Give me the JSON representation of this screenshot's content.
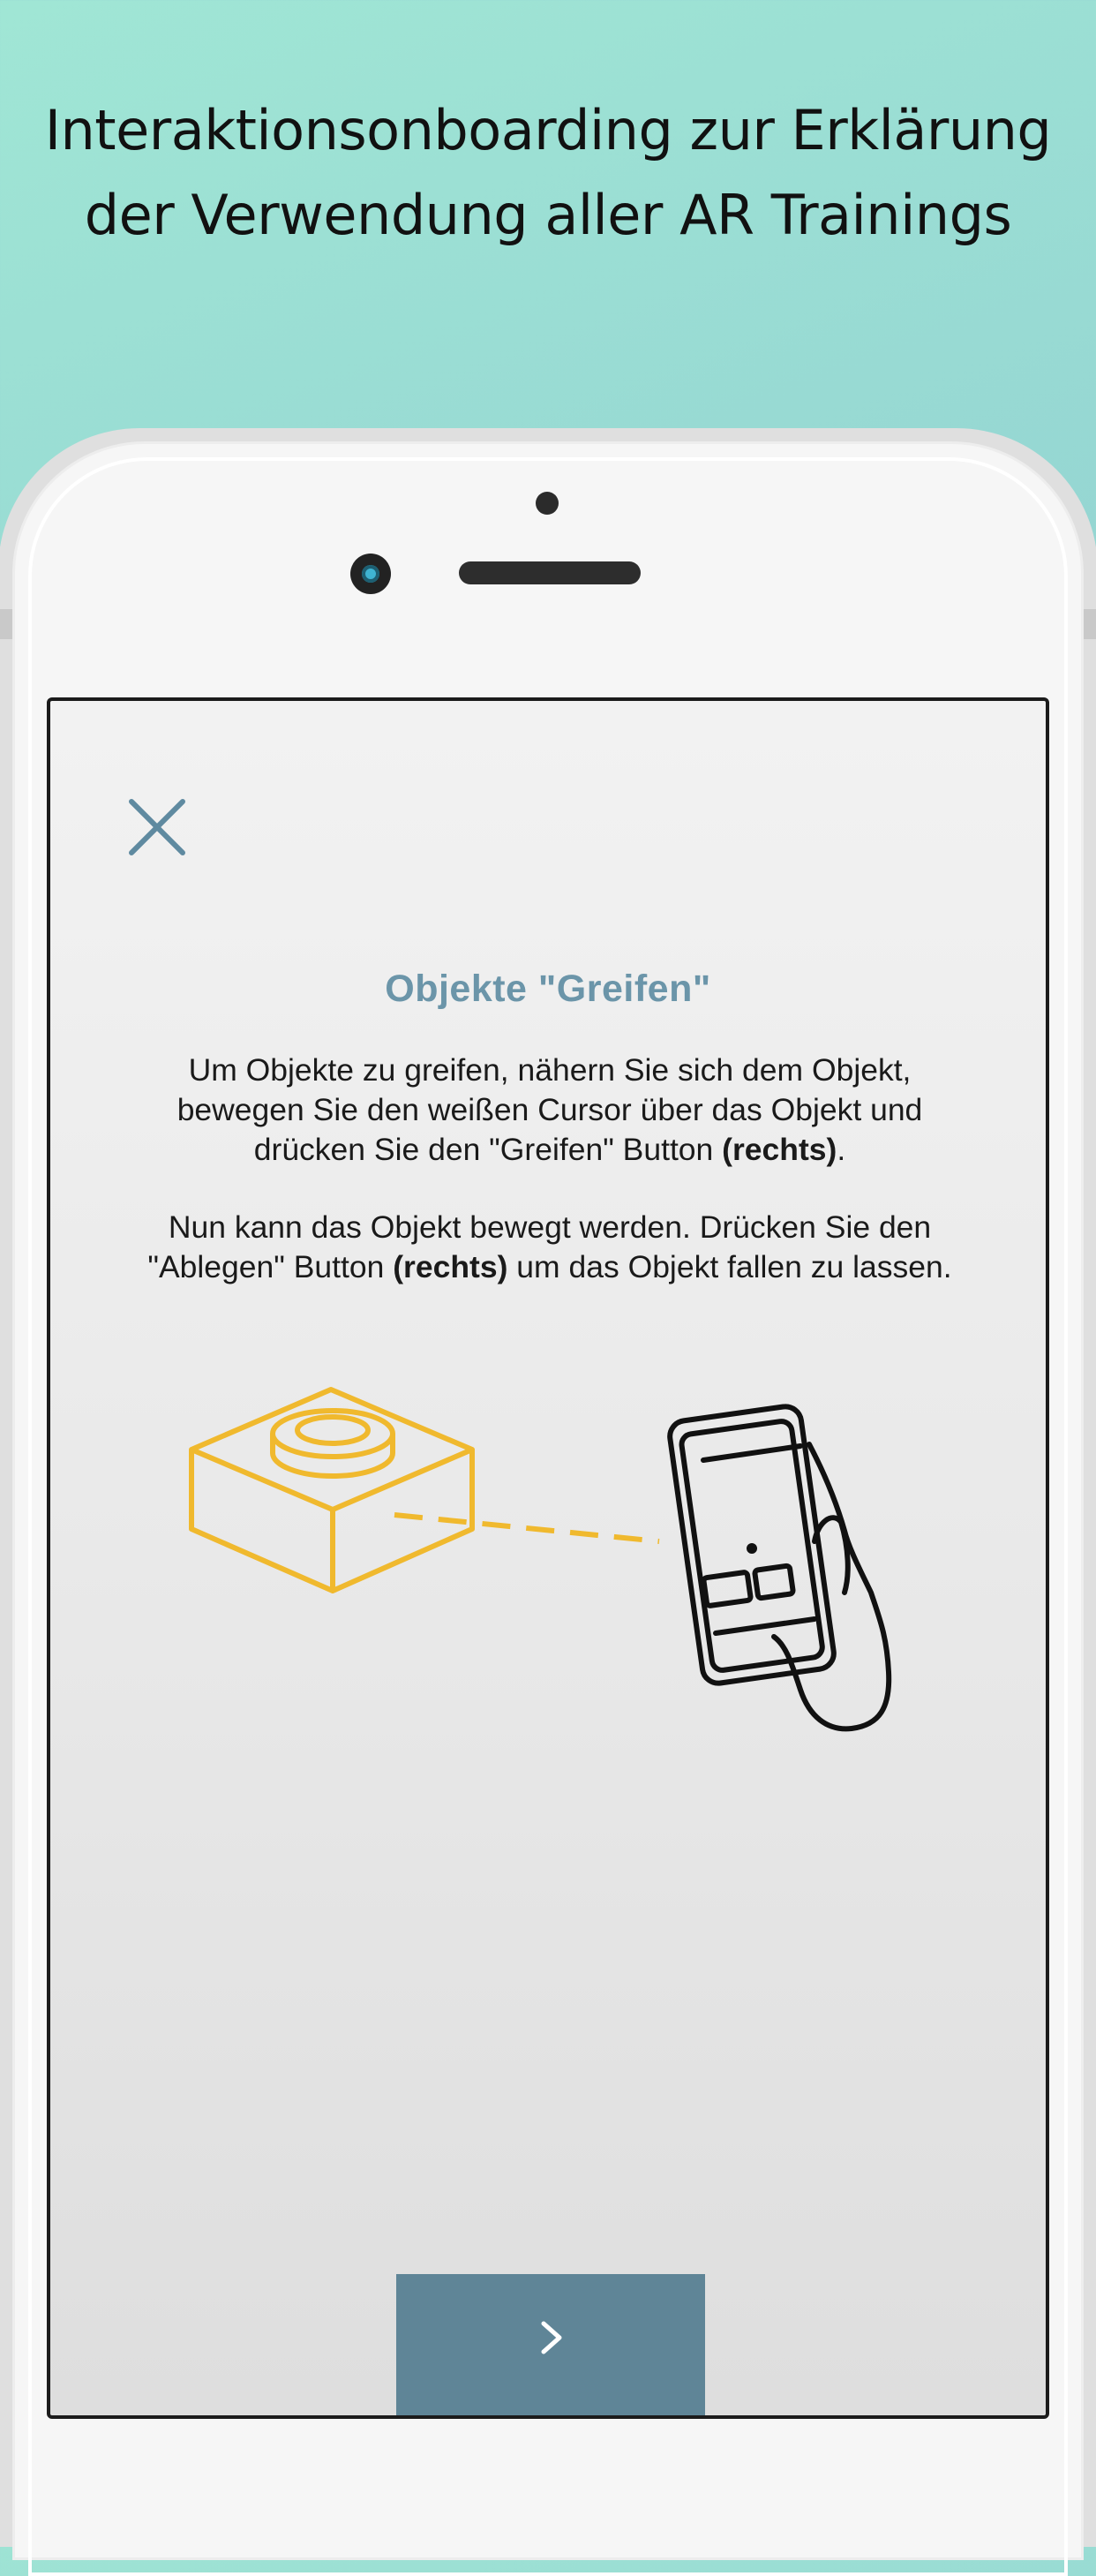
{
  "headline": {
    "line1": "Interaktionsonboarding zur Erklärung",
    "line2": "der Verwendung aller AR Trainings"
  },
  "onboarding": {
    "title": "Objekte \"Greifen\"",
    "paragraph1": {
      "line1": "Um Objekte zu greifen, nähern Sie sich dem Objekt,",
      "line2": "bewegen Sie den weißen Cursor über das Objekt und",
      "line3_pre": "drücken Sie den \"Greifen\" Button ",
      "line3_bold": "(rechts)",
      "line3_post": "."
    },
    "paragraph2": {
      "line1": "Nun kann das Objekt bewegt werden. Drücken Sie den",
      "line2_pre": "\"Ablegen\" Button ",
      "line2_bold": "(rechts)",
      "line2_post": " um das Objekt fallen zu lassen."
    },
    "close_icon": "close-icon",
    "next_icon": "chevron-right-icon",
    "illustration": {
      "object_icon": "lego-brick-icon",
      "device_icon": "hand-holding-phone-icon"
    }
  },
  "colors": {
    "background_top": "#a0e6d5",
    "background_bottom": "#8cc7d6",
    "title": "#6b95a9",
    "accent_yellow": "#f0b92e",
    "next_button": "#5f8597",
    "close_icon": "#5f8aa0"
  }
}
